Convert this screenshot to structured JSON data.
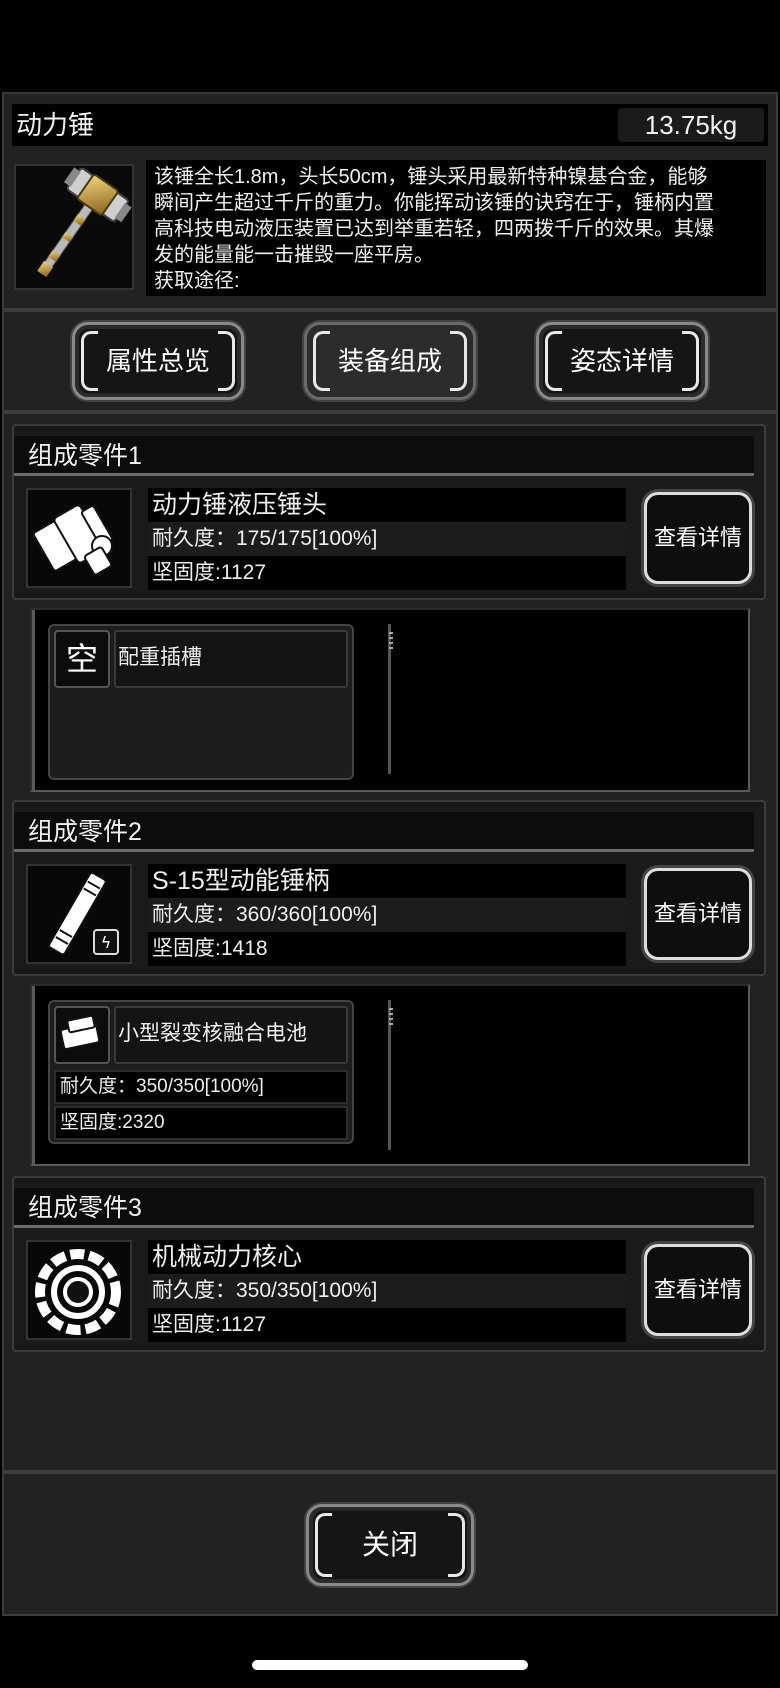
{
  "item": {
    "name": "动力锤",
    "weight": "13.75kg",
    "description_lines": [
      "该锤全长1.8m，头长50cm，锤头采用最新特种镍基合金，能够",
      "瞬间产生超过千斤的重力。你能挥动该锤的诀窍在于，锤柄内置",
      "高科技电动液压装置已达到举重若轻，四两拨千斤的效果。其爆",
      "发的能量能一击摧毁一座平房。",
      "获取途径:"
    ]
  },
  "tabs": [
    {
      "label": "属性总览",
      "active": false
    },
    {
      "label": "装备组成",
      "active": true
    },
    {
      "label": "姿态详情",
      "active": false
    }
  ],
  "parts": [
    {
      "title": "组成零件1",
      "name": "动力锤液压锤头",
      "durability": "耐久度：175/175[100%]",
      "firmness": "坚固度:1127",
      "detail_label": "查看详情",
      "icon": "hammer-head-icon",
      "slot": {
        "icon_text": "空",
        "name": "配重插槽"
      }
    },
    {
      "title": "组成零件2",
      "name": "S-15型动能锤柄",
      "durability": "耐久度：360/360[100%]",
      "firmness": "坚固度:1418",
      "detail_label": "查看详情",
      "icon": "hammer-handle-icon",
      "slot": {
        "icon": "battery-icon",
        "name": "小型裂变核融合电池",
        "durability": "耐久度：350/350[100%]",
        "firmness": "坚固度:2320"
      }
    },
    {
      "title": "组成零件3",
      "name": "机械动力核心",
      "durability": "耐久度：350/350[100%]",
      "firmness": "坚固度:1127",
      "detail_label": "查看详情",
      "icon": "gear-core-icon"
    }
  ],
  "close_label": "关闭"
}
